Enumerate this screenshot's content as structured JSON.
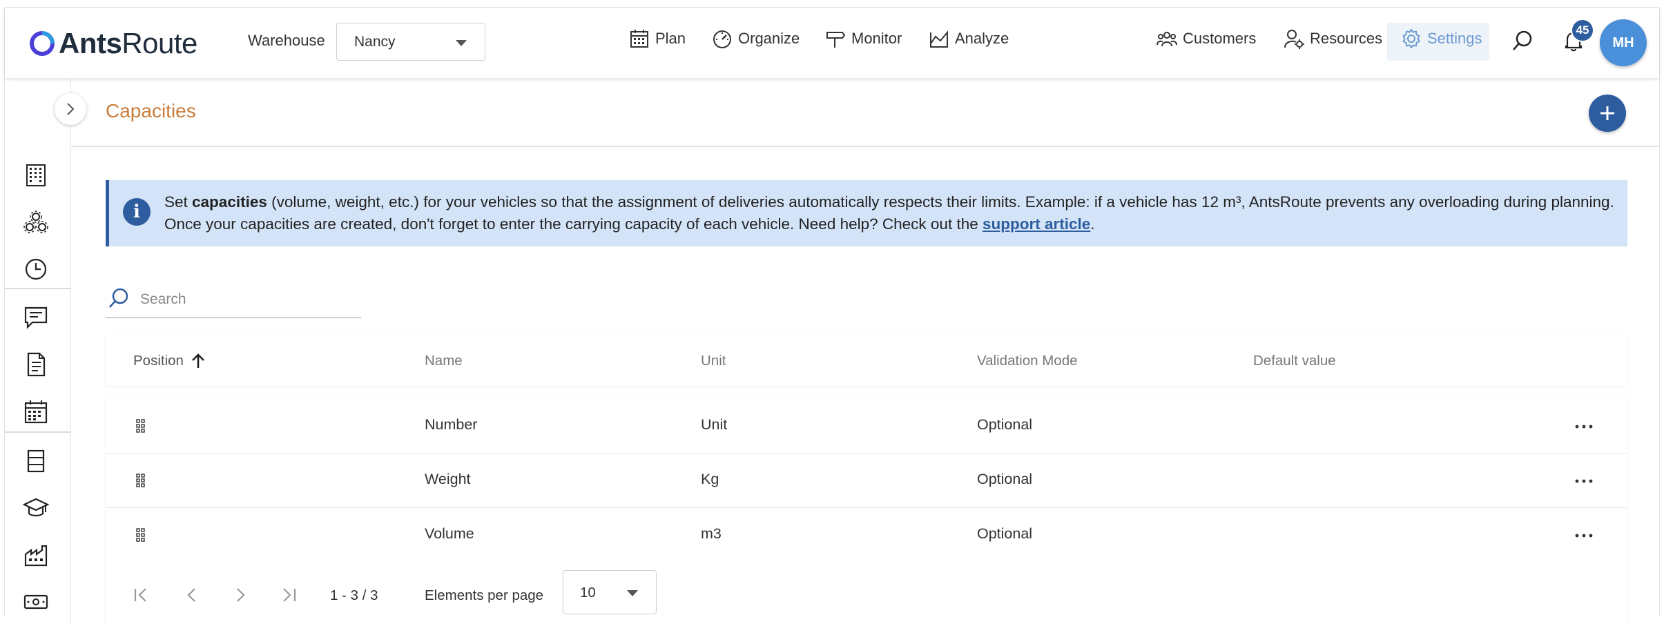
{
  "app": {
    "logo_bold": "Ants",
    "logo_light": "Route"
  },
  "header": {
    "warehouse_label": "Warehouse",
    "warehouse_value": "Nancy",
    "nav": {
      "plan": "Plan",
      "organize": "Organize",
      "monitor": "Monitor",
      "analyze": "Analyze",
      "customers": "Customers",
      "resources": "Resources",
      "settings": "Settings"
    },
    "notifications_count": "45",
    "avatar_initials": "MH"
  },
  "page": {
    "title": "Capacities"
  },
  "info": {
    "text_before": "Set ",
    "bold_word": "capacities",
    "text_after": " (volume, weight, etc.) for your vehicles so that the assignment of deliveries automatically respects their limits. Example: if a vehicle has 12 m³, AntsRoute prevents any overloading during planning. Once your capacities are created, don't forget to enter the carrying capacity of each vehicle. Need help? Check out the ",
    "link_text": "support article",
    "text_end": "."
  },
  "search": {
    "placeholder": "Search"
  },
  "table": {
    "headers": {
      "position": "Position",
      "name": "Name",
      "unit": "Unit",
      "validation_mode": "Validation Mode",
      "default_value": "Default value"
    },
    "rows": [
      {
        "name": "Number",
        "unit": "Unit",
        "validation_mode": "Optional",
        "default_value": ""
      },
      {
        "name": "Weight",
        "unit": "Kg",
        "validation_mode": "Optional",
        "default_value": ""
      },
      {
        "name": "Volume",
        "unit": "m3",
        "validation_mode": "Optional",
        "default_value": ""
      }
    ]
  },
  "pagination": {
    "range": "1 - 3 / 3",
    "elements_per_page_label": "Elements per page",
    "elements_per_page_value": "10"
  },
  "colors": {
    "accent": "#2e5d9f",
    "title": "#c87d3c",
    "info_bg": "#d4e4f8",
    "settings_active": "#6c9bd2"
  }
}
